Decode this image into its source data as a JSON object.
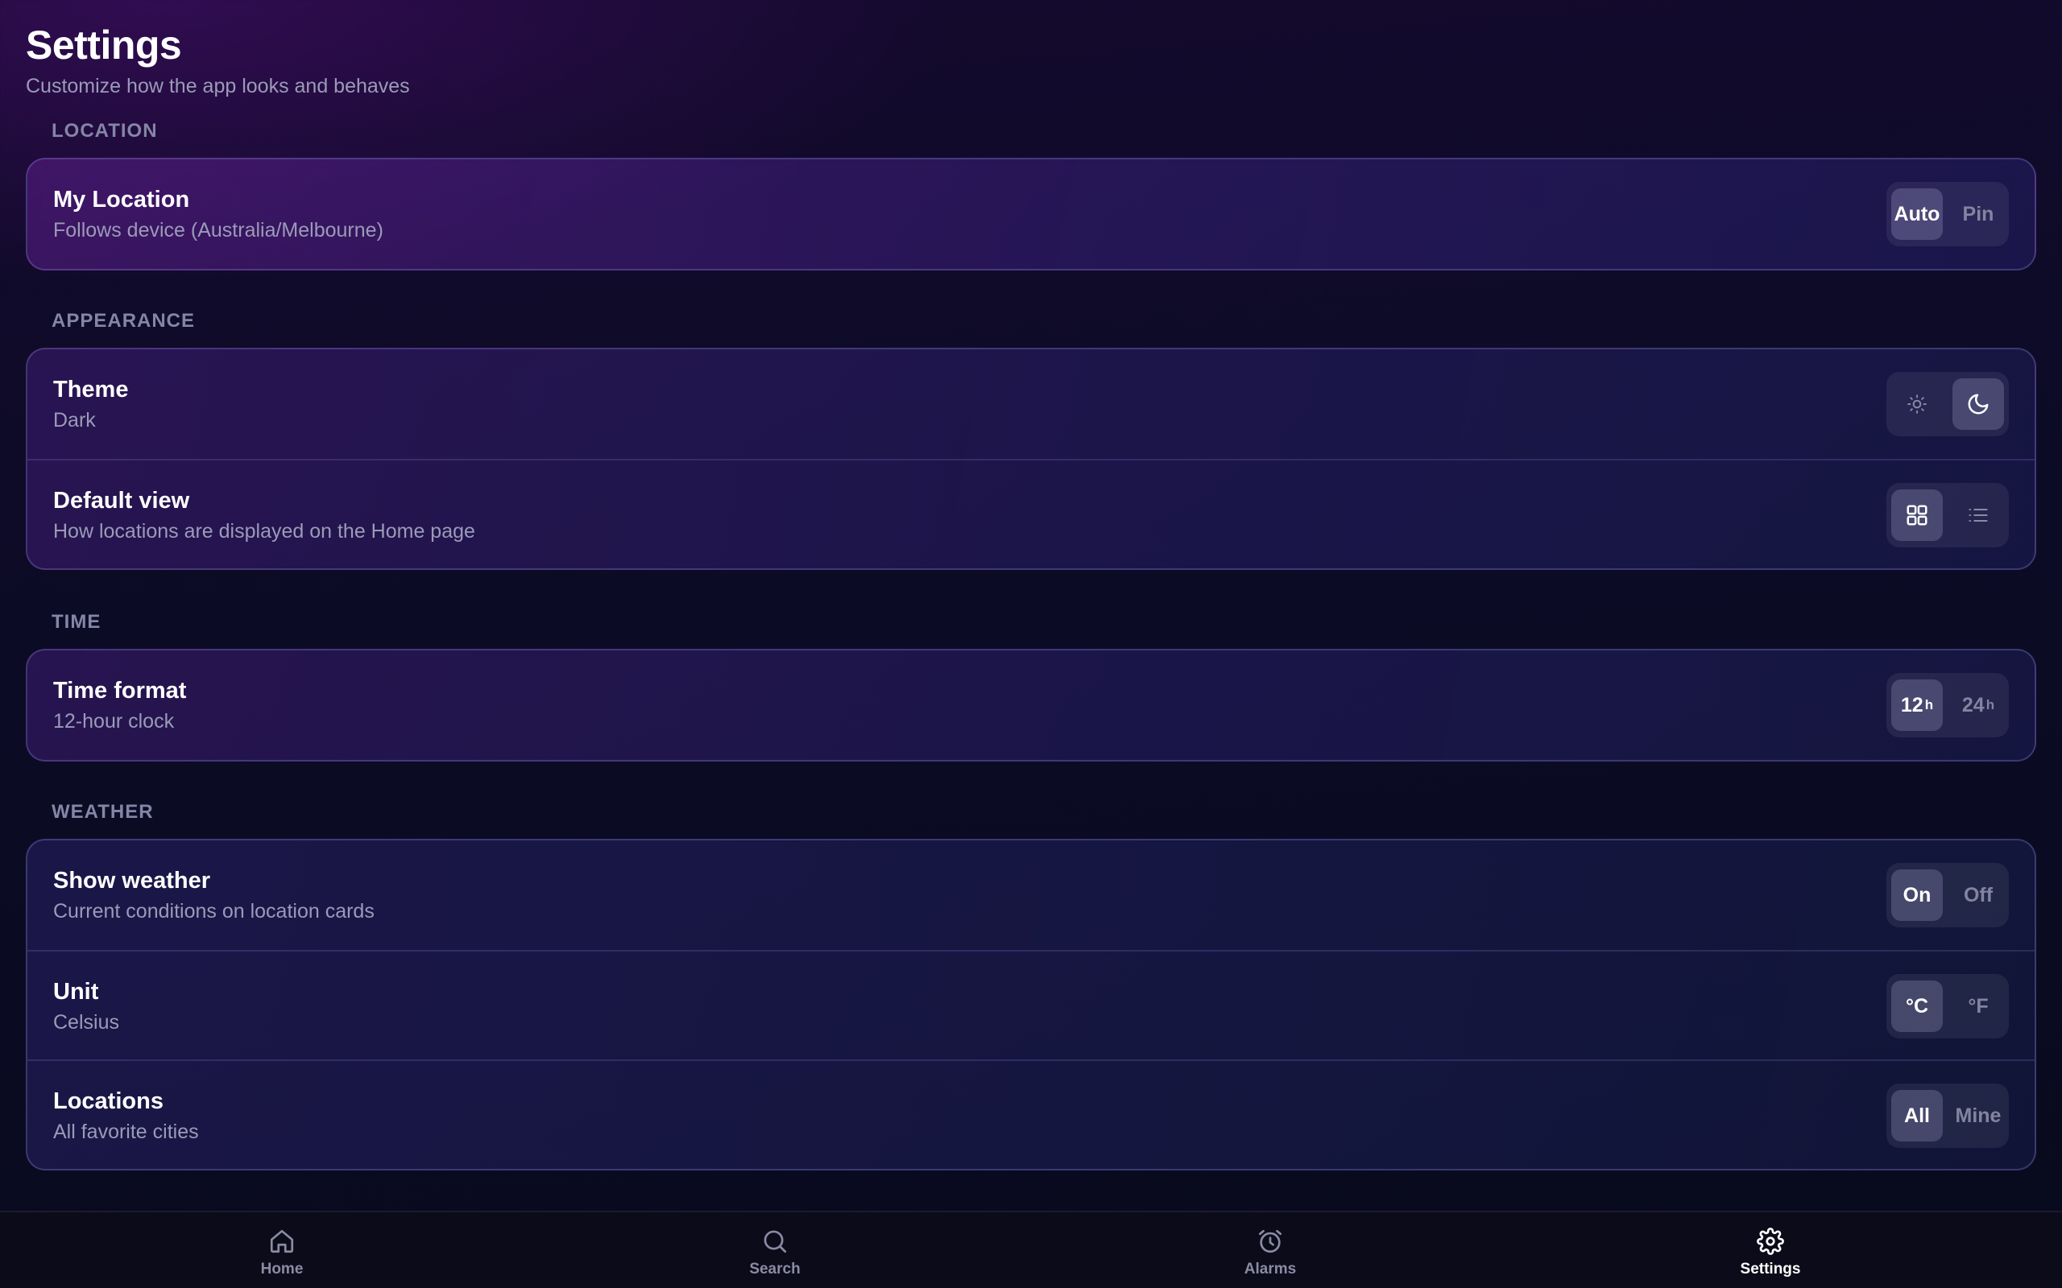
{
  "header": {
    "title": "Settings",
    "subtitle": "Customize how the app looks and behaves"
  },
  "sections": {
    "location": {
      "label": "LOCATION",
      "rows": {
        "my_location": {
          "title": "My Location",
          "subtitle": "Follows device (Australia/Melbourne)",
          "options": [
            "Auto",
            "Pin"
          ],
          "selected": "Auto"
        }
      }
    },
    "appearance": {
      "label": "APPEARANCE",
      "rows": {
        "theme": {
          "title": "Theme",
          "subtitle": "Dark",
          "options": [
            "sun-icon",
            "moon-icon"
          ],
          "selected": "moon-icon"
        },
        "default_view": {
          "title": "Default view",
          "subtitle": "How locations are displayed on the Home page",
          "options": [
            "grid-icon",
            "list-icon"
          ],
          "selected": "grid-icon"
        }
      }
    },
    "time": {
      "label": "TIME",
      "rows": {
        "time_format": {
          "title": "Time format",
          "subtitle": "12-hour clock",
          "options": [
            {
              "value": "12",
              "suffix": "h"
            },
            {
              "value": "24",
              "suffix": "h"
            }
          ],
          "selected": "12h"
        }
      }
    },
    "weather": {
      "label": "WEATHER",
      "rows": {
        "show_weather": {
          "title": "Show weather",
          "subtitle": "Current conditions on location cards",
          "options": [
            "On",
            "Off"
          ],
          "selected": "On"
        },
        "unit": {
          "title": "Unit",
          "subtitle": "Celsius",
          "options": [
            "°C",
            "°F"
          ],
          "selected": "°C"
        },
        "locations": {
          "title": "Locations",
          "subtitle": "All favorite cities",
          "options": [
            "All",
            "Mine"
          ],
          "selected": "All"
        }
      }
    }
  },
  "bottom_nav": {
    "items": [
      {
        "label": "Home",
        "icon": "home-icon"
      },
      {
        "label": "Search",
        "icon": "search-icon"
      },
      {
        "label": "Alarms",
        "icon": "alarm-clock-icon"
      },
      {
        "label": "Settings",
        "icon": "gear-icon"
      }
    ],
    "active": "Settings"
  },
  "colors": {
    "background": "#0d0b27",
    "card_border": "#3a3570",
    "text_primary": "#ffffff",
    "text_secondary": "#9a9bb8",
    "section_label": "#8486a6",
    "segment_inactive": "#83849f"
  }
}
